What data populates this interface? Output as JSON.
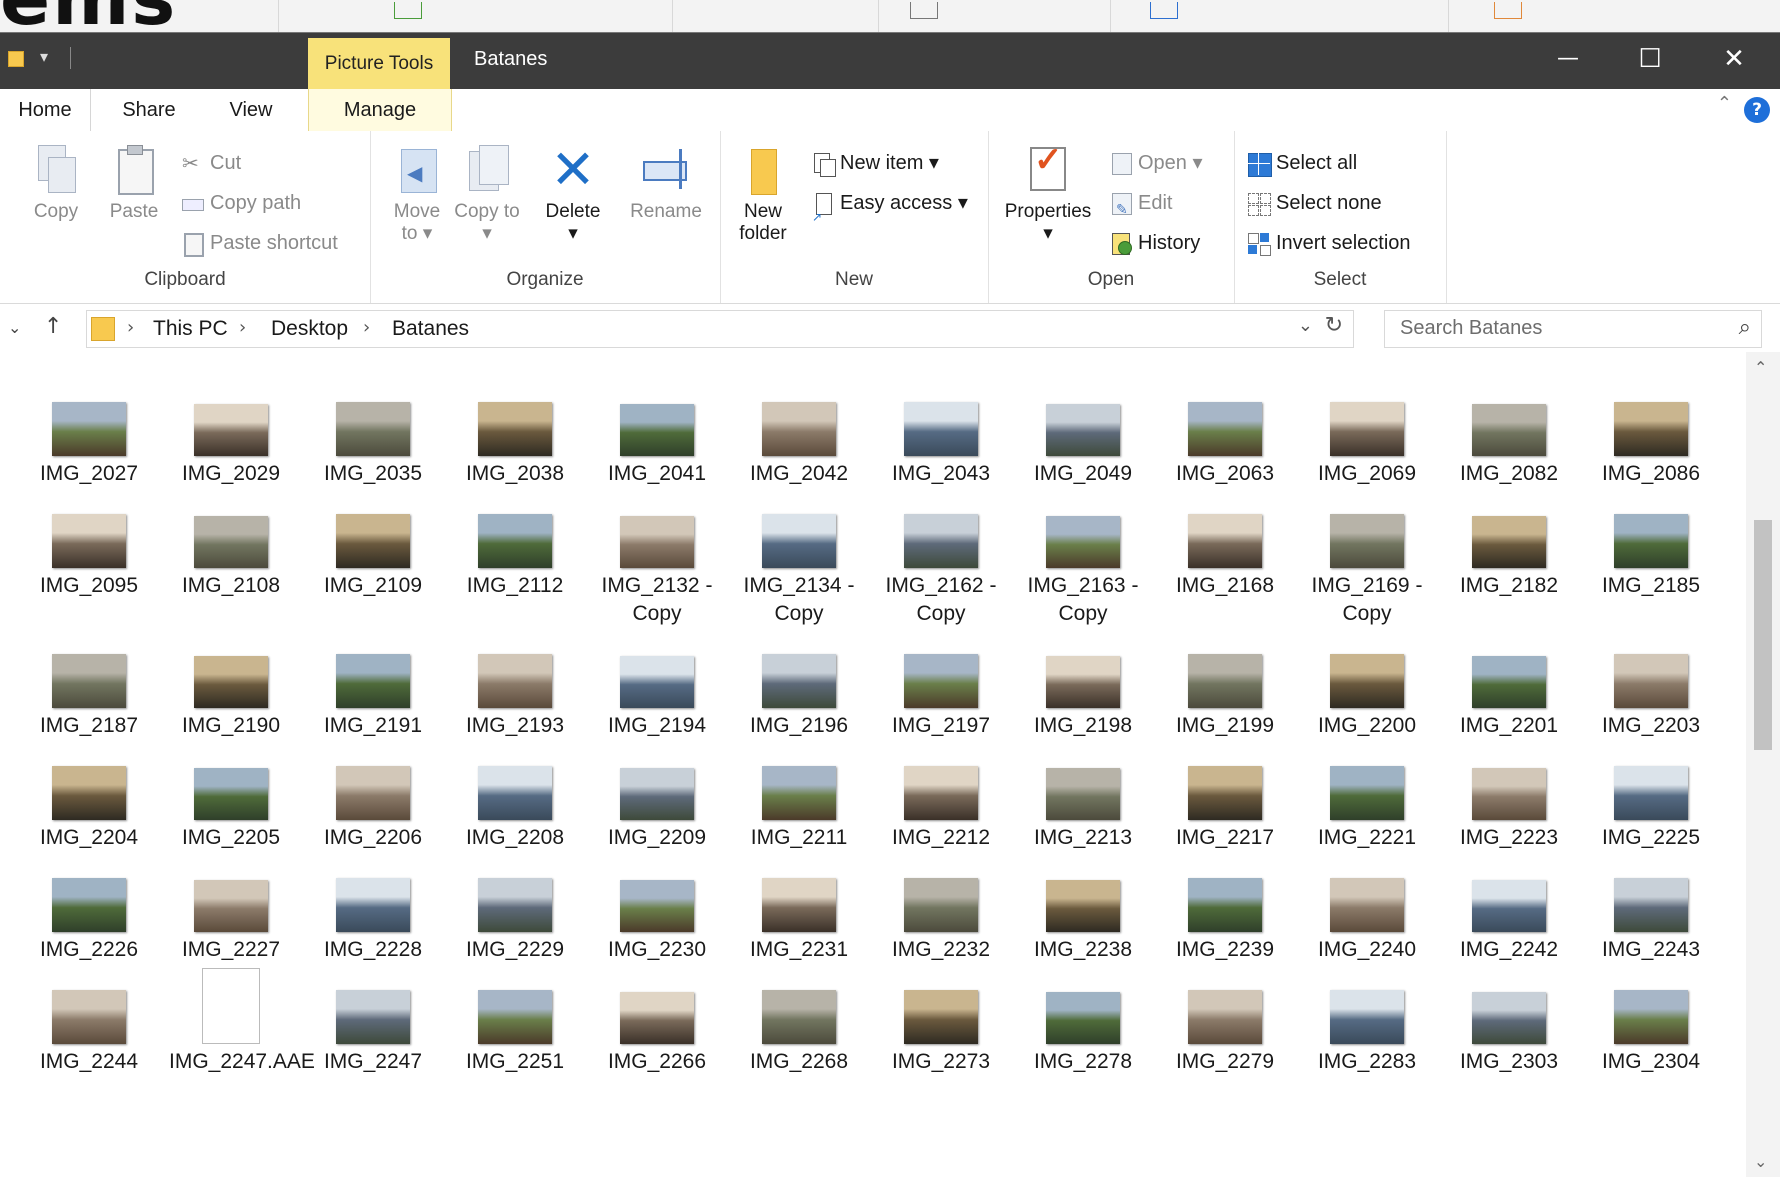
{
  "background": {
    "partial_word": "ems"
  },
  "window": {
    "context_tab": "Picture Tools",
    "title": "Batanes",
    "controls": {
      "minimize": "—",
      "maximize": "☐",
      "close": "✕"
    }
  },
  "ribbon_tabs": [
    "Home",
    "Share",
    "View",
    "Manage"
  ],
  "ribbon": {
    "clipboard": {
      "label": "Clipboard",
      "copy": "Copy",
      "paste": "Paste",
      "cut": "Cut",
      "copy_path": "Copy path",
      "paste_shortcut": "Paste shortcut"
    },
    "organize": {
      "label": "Organize",
      "move_to": "Move to ▾",
      "copy_to": "Copy to ▾",
      "delete": "Delete",
      "delete_arrow": "▾",
      "rename": "Rename"
    },
    "new": {
      "label": "New",
      "new_folder": "New folder",
      "new_item": "New item ▾",
      "easy_access": "Easy access ▾"
    },
    "open": {
      "label": "Open",
      "properties": "Properties",
      "properties_arrow": "▾",
      "open": "Open ▾",
      "edit": "Edit",
      "history": "History"
    },
    "select": {
      "label": "Select",
      "select_all": "Select all",
      "select_none": "Select none",
      "invert_selection": "Invert selection"
    }
  },
  "address": {
    "crumbs": [
      "This PC",
      "Desktop",
      "Batanes"
    ],
    "search_placeholder": "Search Batanes"
  },
  "colors": {
    "titlebar": "#3c3c3c",
    "context_tab": "#f8e27a",
    "accent_blue": "#1e6fd9",
    "folder_yellow": "#f8c94f"
  },
  "files": [
    "IMG_2027",
    "IMG_2029",
    "IMG_2035",
    "IMG_2038",
    "IMG_2041",
    "IMG_2042",
    "IMG_2043",
    "IMG_2049",
    "IMG_2063",
    "IMG_2069",
    "IMG_2082",
    "IMG_2086",
    "IMG_2095",
    "IMG_2108",
    "IMG_2109",
    "IMG_2112",
    "IMG_2132 - Copy",
    "IMG_2134 - Copy",
    "IMG_2162 - Copy",
    "IMG_2163 - Copy",
    "IMG_2168",
    "IMG_2169 - Copy",
    "IMG_2182",
    "IMG_2185",
    "IMG_2187",
    "IMG_2190",
    "IMG_2191",
    "IMG_2193",
    "IMG_2194",
    "IMG_2196",
    "IMG_2197",
    "IMG_2198",
    "IMG_2199",
    "IMG_2200",
    "IMG_2201",
    "IMG_2203",
    "IMG_2204",
    "IMG_2205",
    "IMG_2206",
    "IMG_2208",
    "IMG_2209",
    "IMG_2211",
    "IMG_2212",
    "IMG_2213",
    "IMG_2217",
    "IMG_2221",
    "IMG_2223",
    "IMG_2225",
    "IMG_2226",
    "IMG_2227",
    "IMG_2228",
    "IMG_2229",
    "IMG_2230",
    "IMG_2231",
    "IMG_2232",
    "IMG_2238",
    "IMG_2239",
    "IMG_2240",
    "IMG_2242",
    "IMG_2243",
    "IMG_2244",
    "IMG_2247.AAE",
    "IMG_2247",
    "IMG_2251",
    "IMG_2266",
    "IMG_2268",
    "IMG_2273",
    "IMG_2278",
    "IMG_2279",
    "IMG_2283",
    "IMG_2303",
    "IMG_2304"
  ]
}
